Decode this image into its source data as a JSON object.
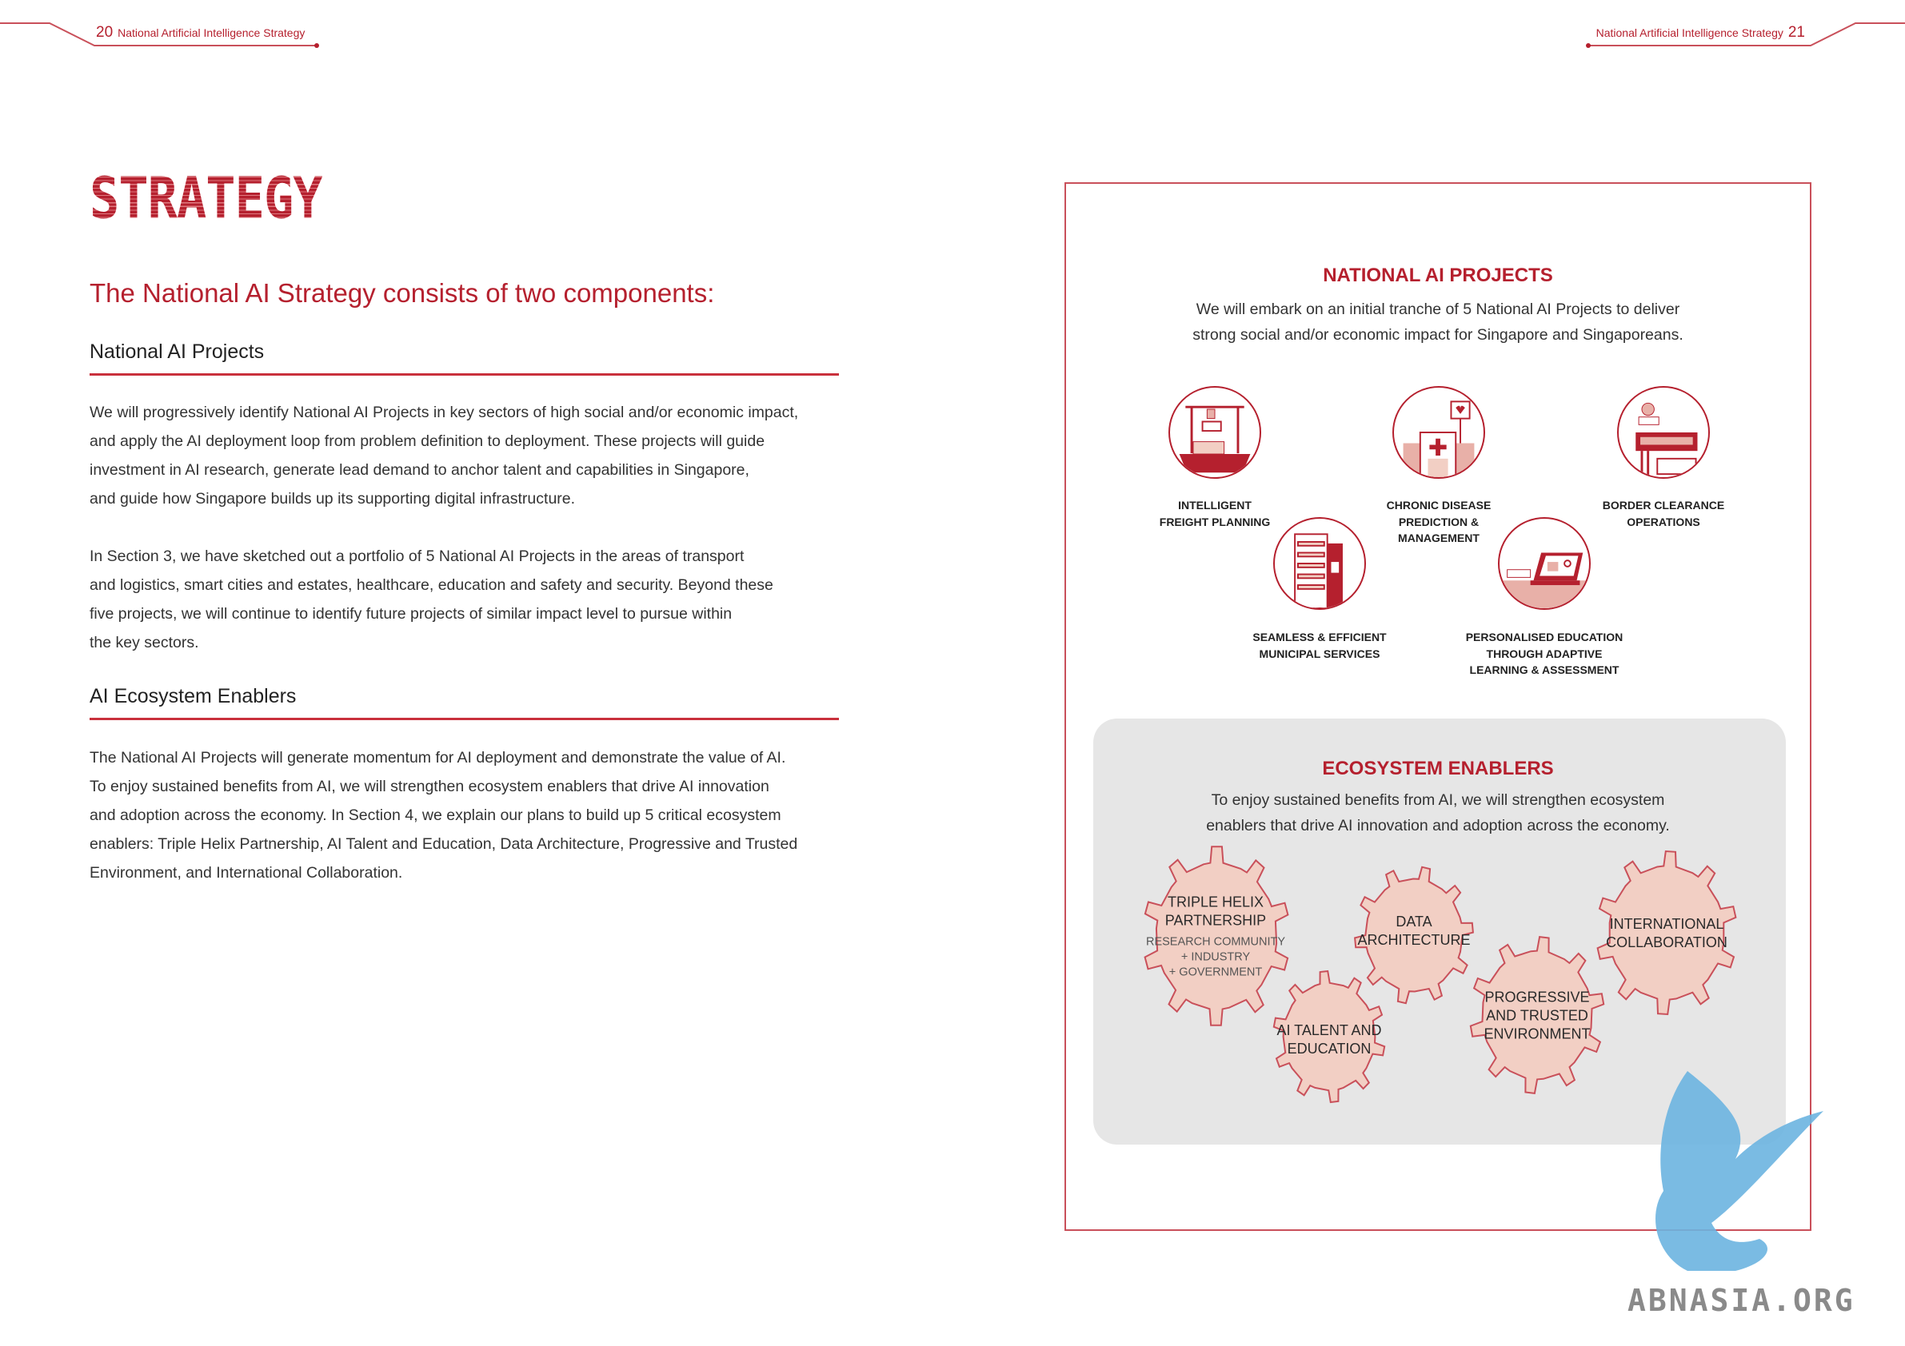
{
  "header_left": {
    "page": "20",
    "title": "National Artificial Intelligence Strategy"
  },
  "header_right": {
    "page": "21",
    "title": "National Artificial Intelligence Strategy"
  },
  "section_title": "STRATEGY",
  "subtitle": "The National AI Strategy consists of two components:",
  "projects_section": {
    "heading": "National AI Projects",
    "para1": [
      "We will progressively identify National AI Projects in key sectors of high social and/or economic impact,",
      "and apply the AI deployment loop from problem definition to deployment. These projects will guide",
      "investment in AI research, generate lead demand to anchor talent and capabilities in Singapore,",
      "and guide how Singapore builds up its supporting digital infrastructure."
    ],
    "para2": [
      "In Section 3, we have sketched out a portfolio of 5 National AI Projects in the areas of transport",
      "and logistics, smart cities and estates, healthcare, education and safety and security. Beyond these",
      "five projects, we will continue to identify future projects of similar impact level to pursue within",
      "the key sectors."
    ]
  },
  "enablers_section": {
    "heading": "AI Ecosystem Enablers",
    "para": [
      "The National AI Projects will generate momentum for AI deployment and demonstrate the value of AI.",
      "To enjoy sustained benefits from AI, we will strengthen ecosystem enablers that drive AI innovation",
      "and adoption across the economy. In Section 4, we explain our plans to build up 5 critical ecosystem",
      "enablers: Triple Helix Partnership, AI Talent and Education, Data Architecture, Progressive and Trusted",
      "Environment, and International Collaboration."
    ]
  },
  "panel": {
    "projects_title": "NATIONAL AI PROJECTS",
    "projects_desc": [
      "We will embark on an initial tranche of 5 National AI Projects to deliver",
      "strong social and/or economic impact for Singapore and Singaporeans."
    ],
    "projects": [
      {
        "icon": "cargo-ship-crane-icon",
        "label": [
          "INTELLIGENT",
          "FREIGHT PLANNING"
        ]
      },
      {
        "icon": "hospital-heart-icon",
        "label": [
          "CHRONIC DISEASE",
          "PREDICTION &",
          "MANAGEMENT"
        ]
      },
      {
        "icon": "border-checkpoint-icon",
        "label": [
          "BORDER CLEARANCE",
          "OPERATIONS"
        ]
      },
      {
        "icon": "municipal-building-icon",
        "label": [
          "SEAMLESS & EFFICIENT",
          "MUNICIPAL SERVICES"
        ]
      },
      {
        "icon": "laptop-education-icon",
        "label": [
          "PERSONALISED EDUCATION",
          "THROUGH ADAPTIVE",
          "LEARNING & ASSESSMENT"
        ]
      }
    ],
    "enablers_title": "ECOSYSTEM ENABLERS",
    "enablers_desc": [
      "To enjoy sustained benefits from AI, we will strengthen ecosystem",
      "enablers that drive AI innovation and adoption across the economy."
    ],
    "enablers": [
      {
        "label": [
          "TRIPLE HELIX",
          "PARTNERSHIP"
        ],
        "sub": [
          "RESEARCH COMMUNITY",
          "+ INDUSTRY",
          "+ GOVERNMENT"
        ]
      },
      {
        "label": [
          "DATA",
          "ARCHITECTURE"
        ]
      },
      {
        "label": [
          "AI TALENT AND",
          "EDUCATION"
        ]
      },
      {
        "label": [
          "PROGRESSIVE",
          "AND TRUSTED",
          "ENVIRONMENT"
        ]
      },
      {
        "label": [
          "INTERNATIONAL",
          "COLLABORATION"
        ]
      }
    ]
  },
  "watermark": "ABNASIA.ORG",
  "colors": {
    "accent": "#b5202e",
    "gear_fill": "#f2cfc4",
    "panel_grey": "#e6e6e6",
    "watermark_blue": "#6cb4e0"
  }
}
